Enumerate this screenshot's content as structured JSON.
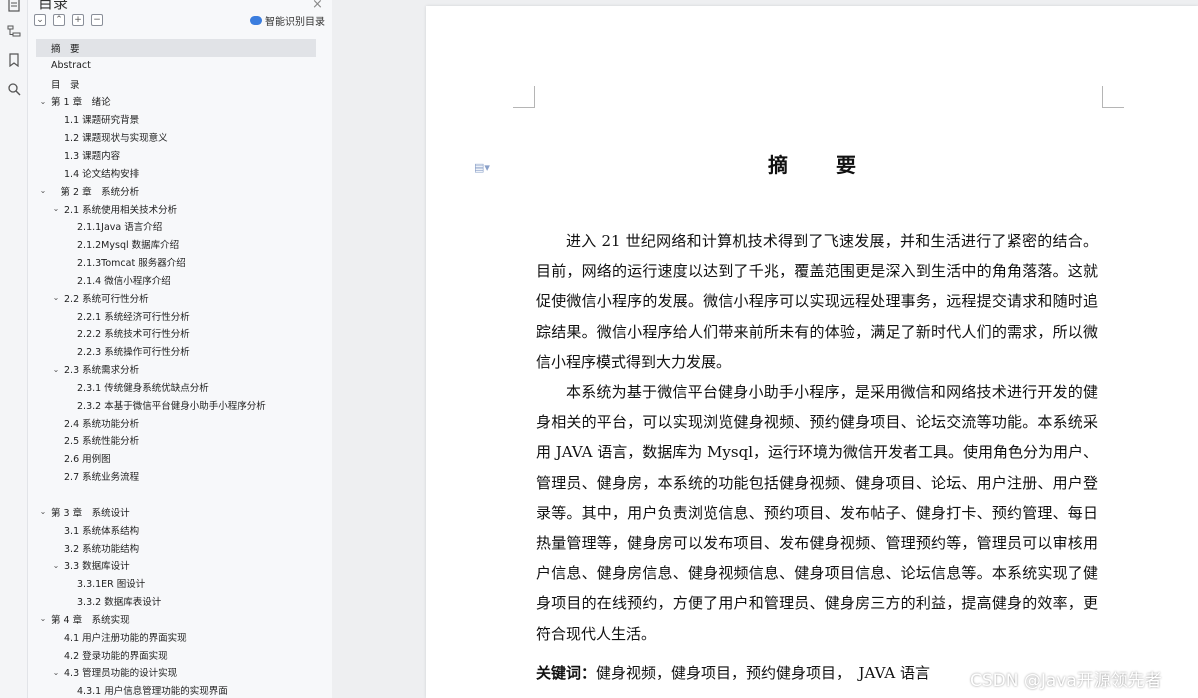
{
  "nav": {
    "title": "目录",
    "close_glyph": "×",
    "toolbar": [
      "⌄",
      "⌃",
      "+",
      "−"
    ],
    "smart_label": "智能识别目录",
    "toc": [
      {
        "label": "摘　要",
        "level": 1,
        "chev": false,
        "active": true
      },
      {
        "label": "Abstract",
        "level": 1,
        "chev": false
      },
      {
        "label": "目　录",
        "level": 1,
        "chev": false
      },
      {
        "label": "第 1 章　绪论",
        "level": 1,
        "chev": true
      },
      {
        "label": "1.1 课题研究背景",
        "level": 2,
        "chev": false
      },
      {
        "label": "1.2 课题现状与实现意义",
        "level": 2,
        "chev": false
      },
      {
        "label": "1.3 课题内容",
        "level": 2,
        "chev": false
      },
      {
        "label": "1.4 论文结构安排",
        "level": 2,
        "chev": false
      },
      {
        "label": "　第 2 章　系统分析",
        "level": 1,
        "chev": true
      },
      {
        "label": "2.1 系统使用相关技术分析",
        "level": 2,
        "chev": true
      },
      {
        "label": "2.1.1Java 语言介绍",
        "level": 3,
        "chev": false
      },
      {
        "label": "2.1.2Mysql 数据库介绍",
        "level": 3,
        "chev": false
      },
      {
        "label": "2.1.3Tomcat 服务器介绍",
        "level": 3,
        "chev": false
      },
      {
        "label": "2.1.4 微信小程序介绍",
        "level": 3,
        "chev": false
      },
      {
        "label": "2.2 系统可行性分析",
        "level": 2,
        "chev": true
      },
      {
        "label": "2.2.1 系统经济可行性分析",
        "level": 3,
        "chev": false
      },
      {
        "label": "2.2.2 系统技术可行性分析",
        "level": 3,
        "chev": false
      },
      {
        "label": "2.2.3 系统操作可行性分析",
        "level": 3,
        "chev": false
      },
      {
        "label": "2.3 系统需求分析",
        "level": 2,
        "chev": true
      },
      {
        "label": "2.3.1 传统健身系统优缺点分析",
        "level": 3,
        "chev": false
      },
      {
        "label": "2.3.2 本基于微信平台健身小助手小程序分析",
        "level": 3,
        "chev": false
      },
      {
        "label": "2.4 系统功能分析",
        "level": 2,
        "chev": false
      },
      {
        "label": "2.5 系统性能分析",
        "level": 2,
        "chev": false
      },
      {
        "label": "2.6 用例图",
        "level": 2,
        "chev": false
      },
      {
        "label": "2.7 系统业务流程",
        "level": 2,
        "chev": false
      },
      {
        "label": "",
        "level": 0,
        "gap": true
      },
      {
        "label": "第 3 章　系统设计",
        "level": 1,
        "chev": true
      },
      {
        "label": "3.1 系统体系结构",
        "level": 2,
        "chev": false
      },
      {
        "label": "3.2 系统功能结构",
        "level": 2,
        "chev": false
      },
      {
        "label": "3.3 数据库设计",
        "level": 2,
        "chev": true
      },
      {
        "label": "3.3.1ER 图设计",
        "level": 3,
        "chev": false
      },
      {
        "label": "3.3.2 数据库表设计",
        "level": 3,
        "chev": false
      },
      {
        "label": "第 4 章　系统实现",
        "level": 1,
        "chev": true
      },
      {
        "label": "4.1 用户注册功能的界面实现",
        "level": 2,
        "chev": false
      },
      {
        "label": "4.2 登录功能的界面实现",
        "level": 2,
        "chev": false
      },
      {
        "label": "4.3 管理员功能的设计实现",
        "level": 2,
        "chev": true
      },
      {
        "label": "4.3.1 用户信息管理功能的实现界面",
        "level": 3,
        "chev": false
      }
    ]
  },
  "document": {
    "title": "摘　要",
    "paragraphs": [
      "进入 21 世纪网络和计算机技术得到了飞速发展，并和生活进行了紧密的结合。目前，网络的运行速度以达到了千兆，覆盖范围更是深入到生活中的角角落落。这就促使微信小程序的发展。微信小程序可以实现远程处理事务，远程提交请求和随时追踪结果。微信小程序给人们带来前所未有的体验，满足了新时代人们的需求，所以微信小程序模式得到大力发展。",
      "本系统为基于微信平台健身小助手小程序，是采用微信和网络技术进行开发的健身相关的平台，可以实现浏览健身视频、预约健身项目、论坛交流等功能。本系统采用 JAVA 语言，数据库为 Mysql，运行环境为微信开发者工具。使用角色分为用户、管理员、健身房，本系统的功能包括健身视频、健身项目、论坛、用户注册、用户登录等。其中，用户负责浏览信息、预约项目、发布帖子、健身打卡、预约管理、每日热量管理等，健身房可以发布项目、发布健身视频、管理预约等，管理员可以审核用户信息、健身房信息、健身视频信息、健身项目信息、论坛信息等。本系统实现了健身项目的在线预约，方便了用户和管理员、健身房三方的利益，提高健身的效率，更符合现代人生活。"
    ],
    "keywords_label": "关键词：",
    "keywords": "健身视频，健身项目，预约健身项目，　JAVA 语言"
  },
  "watermark": "CSDN @Java开源领先者",
  "colors": {
    "accent": "#3b7dde",
    "nav_bg": "#f7f8fa",
    "active_row": "#e1e3e7",
    "page_bg": "#ffffff"
  }
}
